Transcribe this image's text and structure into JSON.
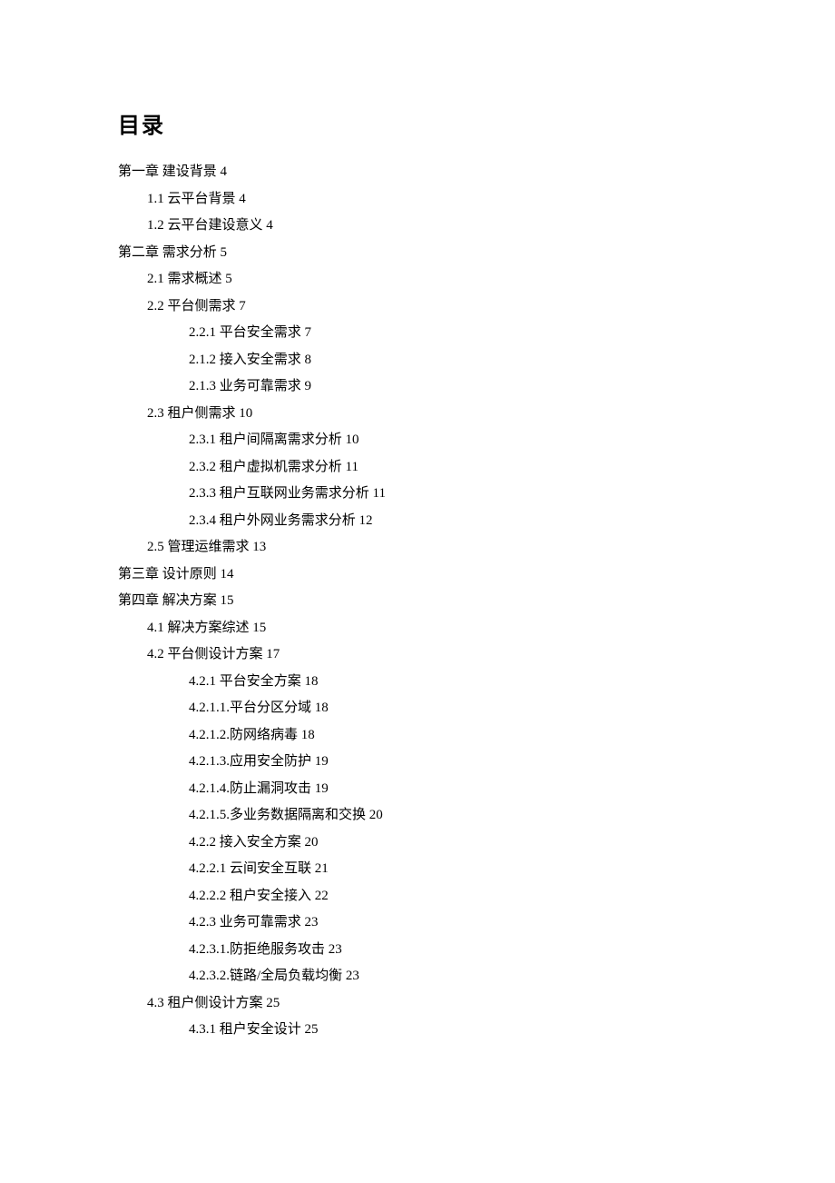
{
  "title": "目录",
  "entries": [
    {
      "indent": 0,
      "label": "第一章 建设背景",
      "page": "4"
    },
    {
      "indent": 1,
      "label": "1.1 云平台背景",
      "page": "4"
    },
    {
      "indent": 1,
      "label": "1.2 云平台建设意义",
      "page": "4"
    },
    {
      "indent": 0,
      "label": "第二章 需求分析",
      "page": "5"
    },
    {
      "indent": 1,
      "label": "2.1 需求概述",
      "page": "5"
    },
    {
      "indent": 1,
      "label": "2.2 平台侧需求",
      "page": "7"
    },
    {
      "indent": 2,
      "label": "2.2.1 平台安全需求",
      "page": "7"
    },
    {
      "indent": 2,
      "label": "2.1.2 接入安全需求",
      "page": "8"
    },
    {
      "indent": 2,
      "label": "2.1.3 业务可靠需求",
      "page": "9"
    },
    {
      "indent": 1,
      "label": "2.3 租户侧需求",
      "page": "10"
    },
    {
      "indent": 2,
      "label": "2.3.1 租户间隔离需求分析",
      "page": "10"
    },
    {
      "indent": 2,
      "label": "2.3.2 租户虚拟机需求分析",
      "page": "11"
    },
    {
      "indent": 2,
      "label": "2.3.3 租户互联网业务需求分析",
      "page": "11"
    },
    {
      "indent": 2,
      "label": "2.3.4 租户外网业务需求分析",
      "page": "12"
    },
    {
      "indent": 1,
      "label": "2.5 管理运维需求",
      "page": "13"
    },
    {
      "indent": 0,
      "label": "第三章 设计原则",
      "page": "14"
    },
    {
      "indent": 0,
      "label": "第四章 解决方案",
      "page": "15"
    },
    {
      "indent": 1,
      "label": "4.1 解决方案综述",
      "page": "15"
    },
    {
      "indent": 1,
      "label": "4.2 平台侧设计方案",
      "page": "17"
    },
    {
      "indent": 2,
      "label": "4.2.1 平台安全方案",
      "page": "18"
    },
    {
      "indent": 2,
      "label": "4.2.1.1.平台分区分域",
      "page": "18"
    },
    {
      "indent": 2,
      "label": "4.2.1.2.防网络病毒",
      "page": "18"
    },
    {
      "indent": 2,
      "label": "4.2.1.3.应用安全防护",
      "page": "19"
    },
    {
      "indent": 2,
      "label": "4.2.1.4.防止漏洞攻击",
      "page": "19"
    },
    {
      "indent": 2,
      "label": "4.2.1.5.多业务数据隔离和交换",
      "page": "20"
    },
    {
      "indent": 2,
      "label": "4.2.2 接入安全方案",
      "page": "20"
    },
    {
      "indent": 2,
      "label": "4.2.2.1 云间安全互联",
      "page": "21"
    },
    {
      "indent": 2,
      "label": "4.2.2.2 租户安全接入",
      "page": "22"
    },
    {
      "indent": 2,
      "label": "4.2.3 业务可靠需求",
      "page": "23"
    },
    {
      "indent": 2,
      "label": "4.2.3.1.防拒绝服务攻击",
      "page": "23"
    },
    {
      "indent": 2,
      "label": "4.2.3.2.链路/全局负载均衡",
      "page": "23"
    },
    {
      "indent": 1,
      "label": "4.3 租户侧设计方案",
      "page": "25"
    },
    {
      "indent": 2,
      "label": "4.3.1 租户安全设计",
      "page": "25"
    }
  ]
}
